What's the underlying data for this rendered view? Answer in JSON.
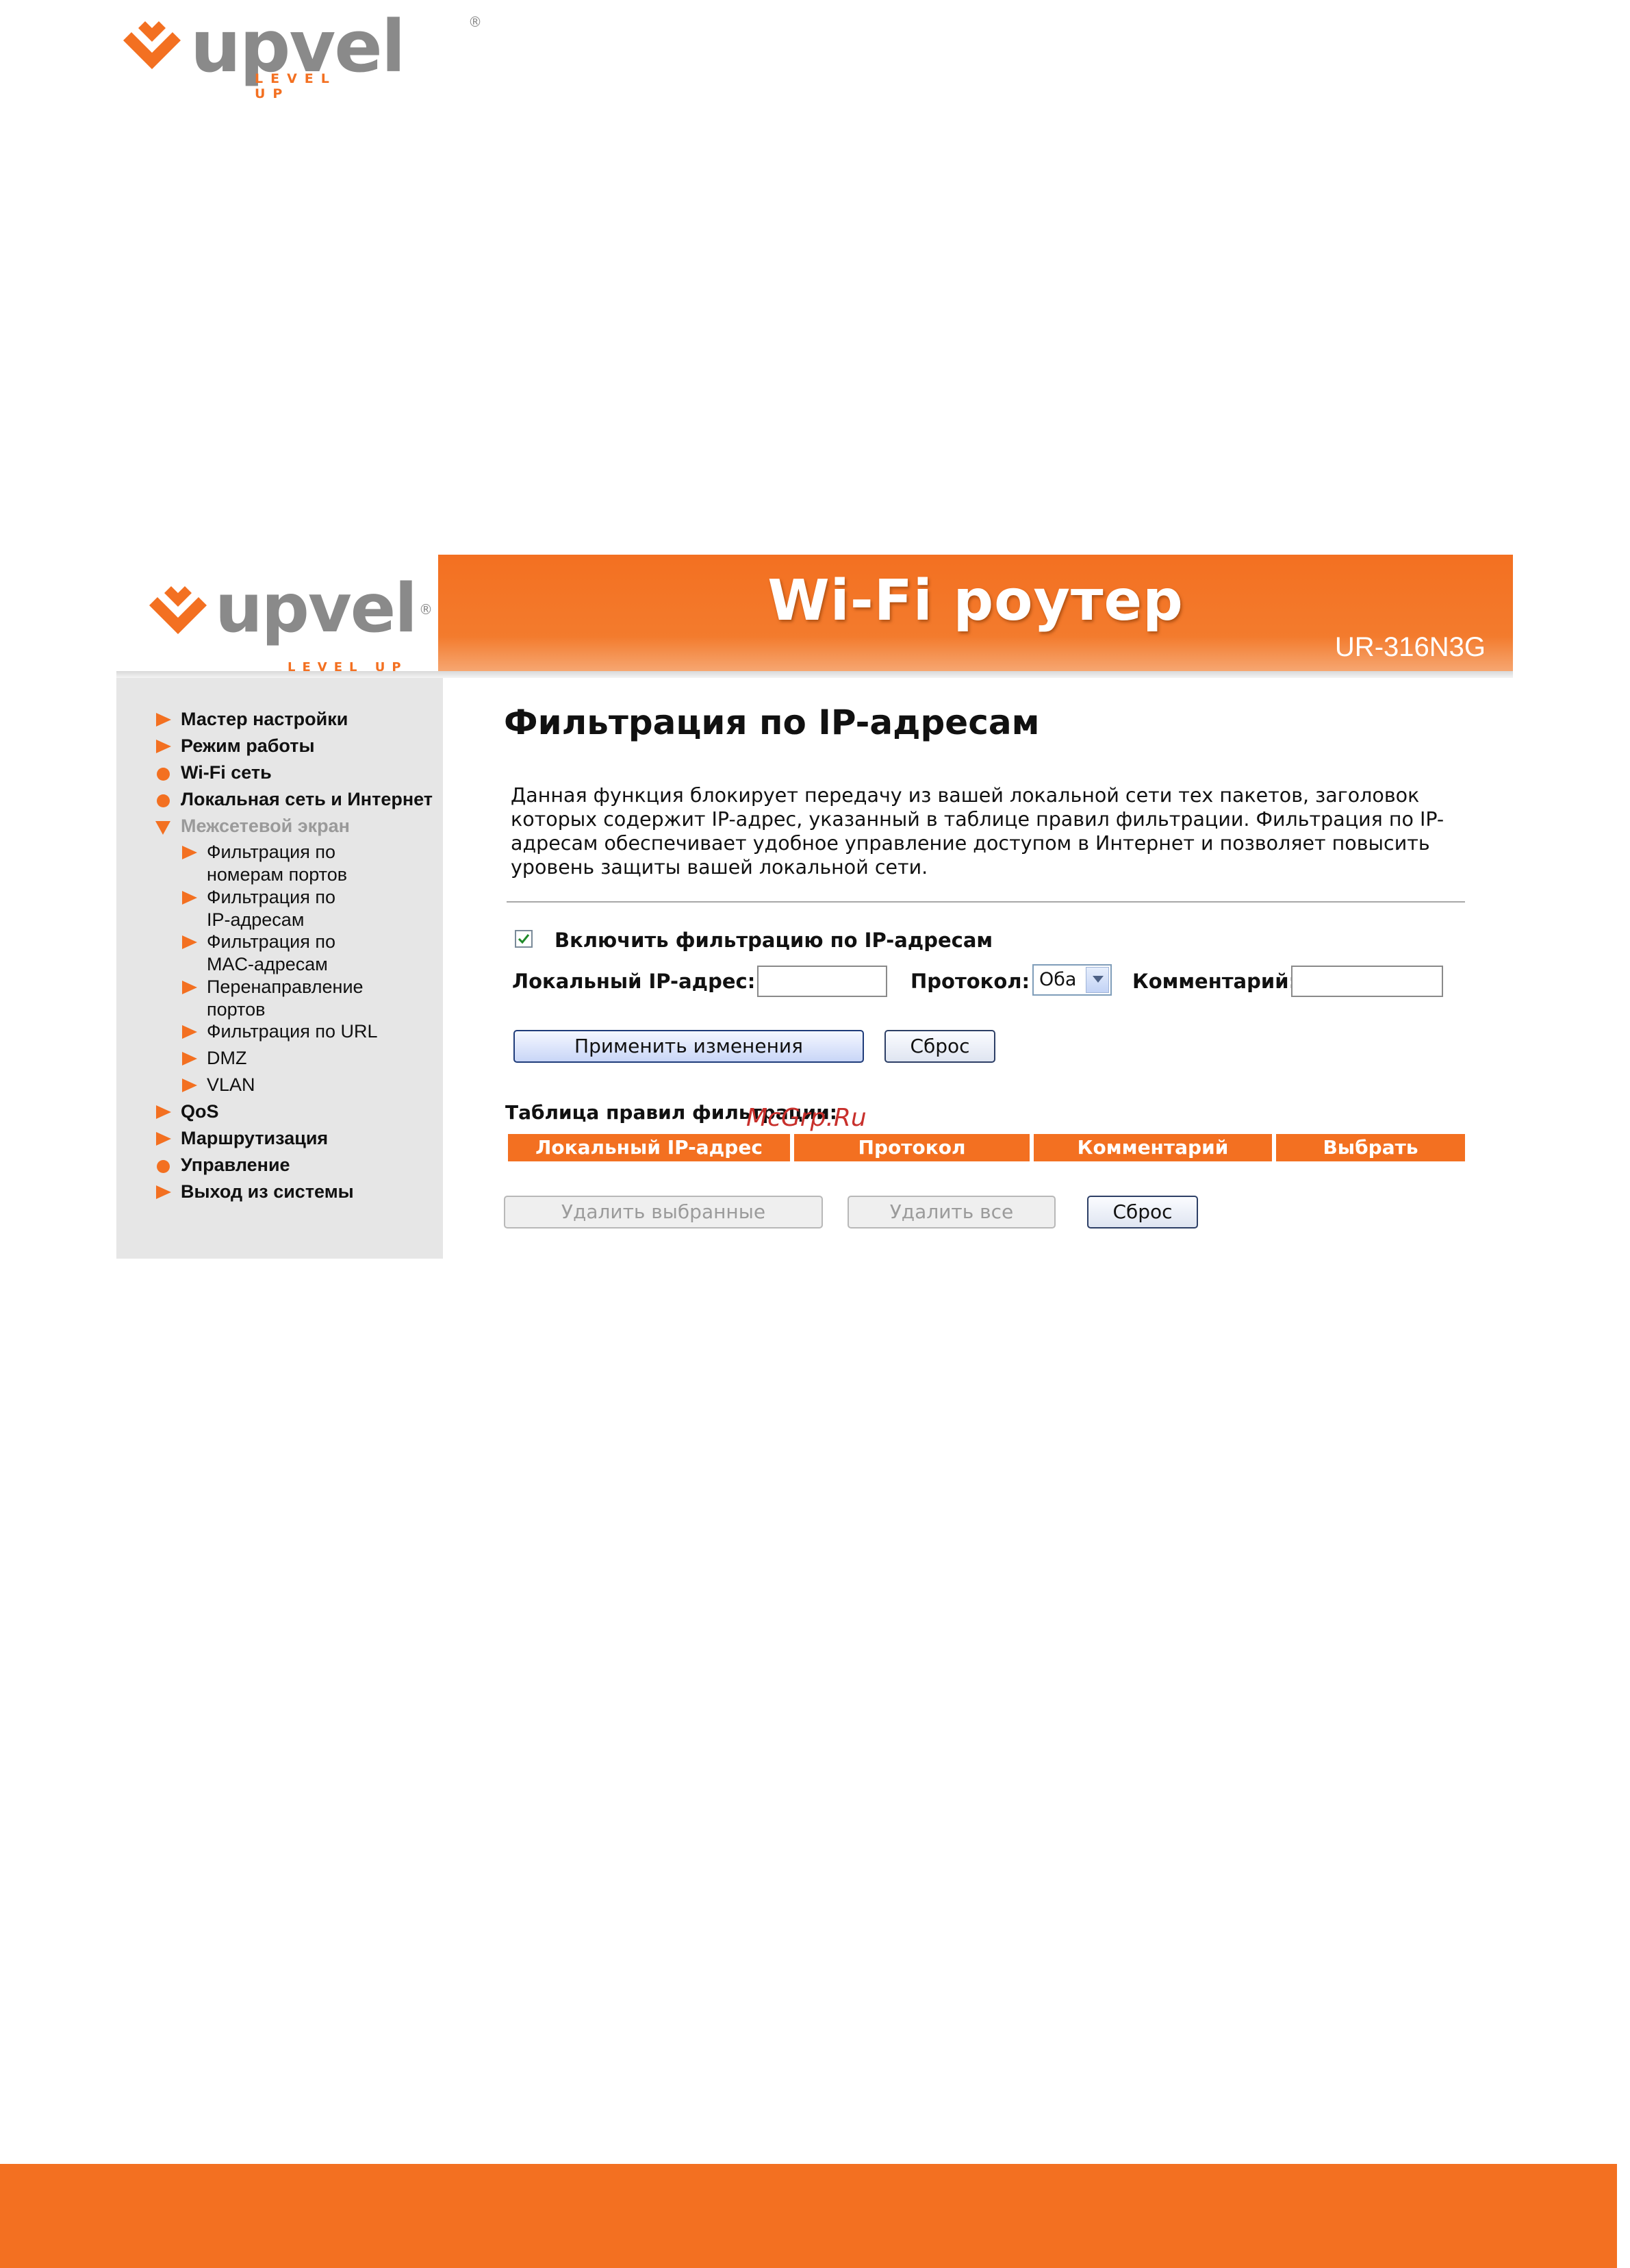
{
  "page_logo": {
    "wordmark": "upvel",
    "tagline": "LEVEL UP",
    "registered": "®"
  },
  "header": {
    "logo": {
      "wordmark": "upvel",
      "tagline": "LEVEL UP",
      "registered": "®"
    },
    "title": "Wi-Fi роутер",
    "model": "UR-316N3G"
  },
  "sidebar": {
    "items": [
      {
        "label": "Мастер настройки",
        "icon": "triangle-right-icon"
      },
      {
        "label": "Режим работы",
        "icon": "triangle-right-icon"
      },
      {
        "label": "Wi-Fi сеть",
        "icon": "dot-icon"
      },
      {
        "label": "Локальная сеть и Интернет",
        "icon": "dot-icon"
      },
      {
        "label": "Межсетевой экран",
        "icon": "triangle-down-icon",
        "expanded": true
      },
      {
        "label": "QoS",
        "icon": "triangle-right-icon"
      },
      {
        "label": "Маршрутизация",
        "icon": "triangle-right-icon"
      },
      {
        "label": "Управление",
        "icon": "dot-icon"
      },
      {
        "label": "Выход из системы",
        "icon": "triangle-right-icon"
      }
    ],
    "subitems": [
      {
        "line1": "Фильтрация по",
        "line2": "номерам портов"
      },
      {
        "line1": "Фильтрация по",
        "line2": "IP-адресам"
      },
      {
        "line1": "Фильтрация по",
        "line2": "MAC-адресам"
      },
      {
        "line1": "Перенаправление",
        "line2": "портов"
      },
      {
        "line1": "Фильтрация по URL",
        "line2": ""
      },
      {
        "line1": "DMZ",
        "line2": ""
      },
      {
        "line1": "VLAN",
        "line2": ""
      }
    ]
  },
  "main": {
    "heading": "Фильтрация по IP-адресам",
    "description": "Данная функция блокирует передачу из вашей локальной сети тех пакетов, заголовок которых содержит IP-адрес, указанный в таблице правил фильтрации. Фильтрация по IP-адресам обеспечивает удобное управление доступом в Интернет и позволяет повысить уровень защиты вашей локальной сети.",
    "enable_label": "Включить фильтрацию по IP-адресам",
    "enable_checked": true,
    "local_ip_label": "Локальный IP-адрес:",
    "local_ip_value": "",
    "protocol_label": "Протокол:",
    "protocol_value": "Оба",
    "comment_label": "Комментарий:",
    "comment_value": "",
    "apply_button": "Применить изменения",
    "reset_button": "Сброс",
    "table_title": "Таблица правил фильтрации:",
    "table_headers": [
      "Локальный IP-адрес",
      "Протокол",
      "Комментарий",
      "Выбрать"
    ],
    "delete_selected_button": "Удалить выбранные",
    "delete_all_button": "Удалить все",
    "table_reset_button": "Сброс"
  },
  "watermark": "McGrp.Ru",
  "colors": {
    "accent": "#f37021",
    "logo_gray": "#8a8a8a",
    "sidebar_bg": "#e6e6e6"
  }
}
